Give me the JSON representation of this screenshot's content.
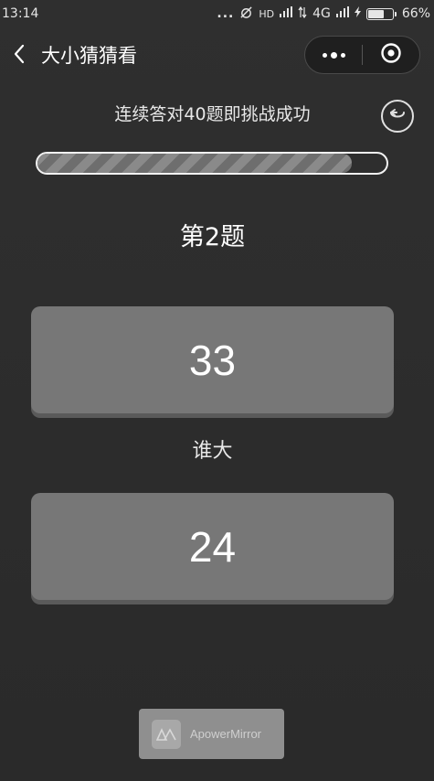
{
  "status_bar": {
    "time": "13:14",
    "dots": "...",
    "hd_label": "HD",
    "network": "4G",
    "battery": "66%",
    "battery_level": 0.66
  },
  "nav": {
    "title": "大小猜猜看",
    "back_icon": "chevron-left-icon",
    "more_icon": "more-dots-icon",
    "close_icon": "target-close-icon"
  },
  "game": {
    "instruction": "连续答对40题即挑战成功",
    "restart_icon": "restart-icon",
    "progress": 0.9,
    "question_number": "第2题",
    "option_a": "33",
    "prompt": "谁大",
    "option_b": "24"
  },
  "watermark": {
    "text": "ApowerMirror"
  },
  "colors": {
    "background": "#2c2c2c",
    "card": "#777777",
    "card_shadow": "#5a5a5a",
    "text": "#ffffff"
  }
}
